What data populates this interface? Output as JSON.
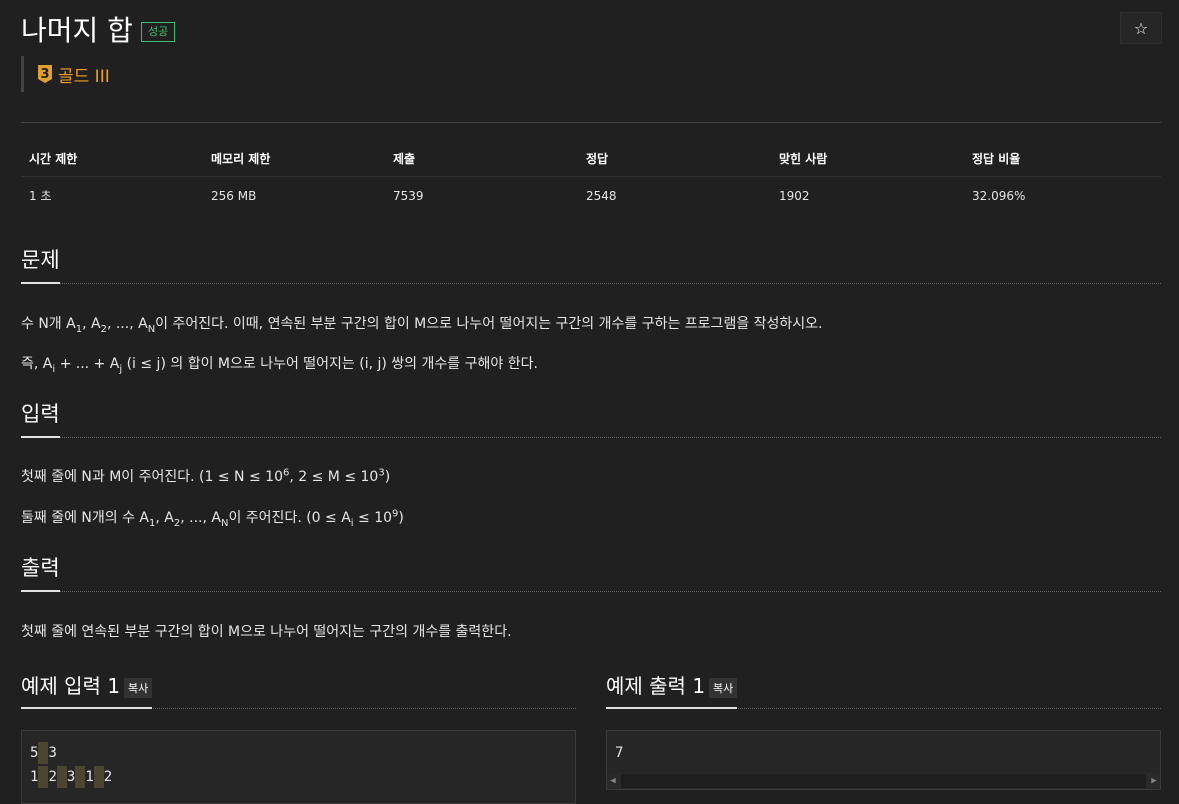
{
  "header": {
    "title": "나머지 합",
    "badge": "성공",
    "star_icon": "☆",
    "tier_number": "3",
    "tier_label": "골드 III"
  },
  "stats": {
    "headers": [
      "시간 제한",
      "메모리 제한",
      "제출",
      "정답",
      "맞힌 사람",
      "정답 비율"
    ],
    "values": [
      "1 초",
      "256 MB",
      "7539",
      "2548",
      "1902",
      "32.096%"
    ]
  },
  "problem": {
    "heading": "문제",
    "line1_prefix": "수 N개 A",
    "line1_after_a1": ", A",
    "line1_after_a2": ", ..., A",
    "line1_rest": "이 주어진다. 이때, 연속된 부분 구간의 합이 M으로 나누어 떨어지는 구간의 개수를 구하는 프로그램을 작성하시오.",
    "line2_prefix": "즉, A",
    "line2_mid": " + ... + A",
    "line2_rest": " (i ≤ j) 의 합이 M으로 나누어 떨어지는 (i, j) 쌍의 개수를 구해야 한다.",
    "sub_1": "1",
    "sub_2": "2",
    "sub_N": "N",
    "sub_i": "i",
    "sub_j": "j"
  },
  "input": {
    "heading": "입력",
    "line1_prefix": "첫째 줄에 N과 M이 주어진다. (1 ≤ N ≤ 10",
    "line1_sup1": "6",
    "line1_mid": ", 2 ≤ M ≤ 10",
    "line1_sup2": "3",
    "line1_end": ")",
    "line2_prefix": "둘째 줄에 N개의 수 A",
    "line2_a": ", A",
    "line2_b": ", ..., A",
    "line2_c": "이 주어진다. (0 ≤ A",
    "line2_d": " ≤ 10",
    "line2_sup": "9",
    "line2_end": ")"
  },
  "output": {
    "heading": "출력",
    "line1": "첫째 줄에 연속된 부분 구간의 합이 M으로 나누어 떨어지는 구간의 개수를 출력한다."
  },
  "examples": {
    "input_heading": "예제 입력 1",
    "output_heading": "예제 출력 1",
    "copy_label": "복사",
    "input_lines": [
      [
        "5",
        "3"
      ],
      [
        "1",
        "2",
        "3",
        "1",
        "2"
      ]
    ],
    "output_value": "7"
  },
  "colors": {
    "background": "#202020",
    "success_badge": "#3fbf6f",
    "tier_gold": "#f0a020"
  }
}
